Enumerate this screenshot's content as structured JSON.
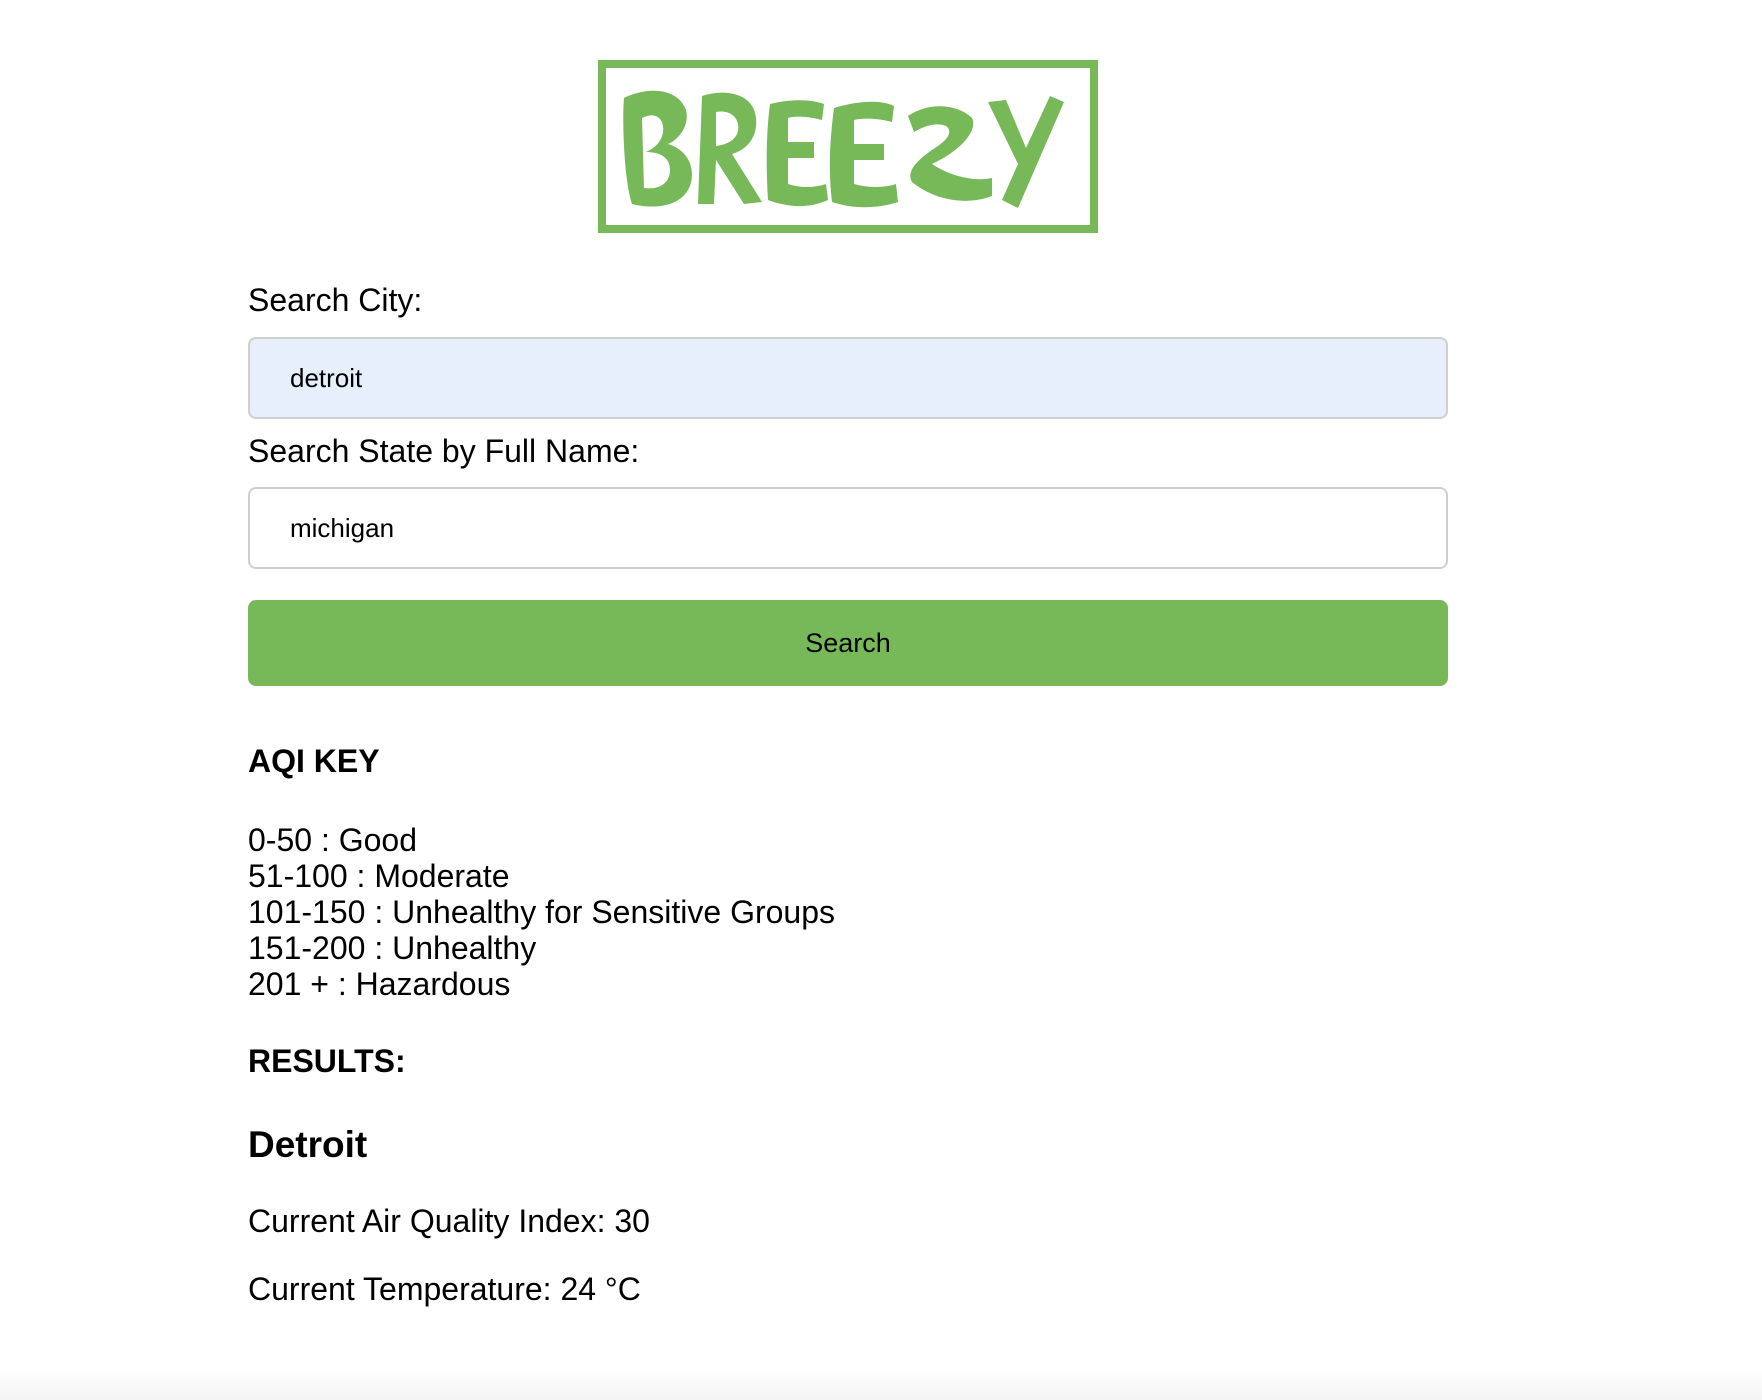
{
  "logo": {
    "text": "BREEZY"
  },
  "colors": {
    "brand_green": "#77b959",
    "city_input_bg": "#e8effc",
    "state_input_bg": "#ffffff"
  },
  "search": {
    "city_label": "Search City:",
    "city_value": "detroit",
    "state_label": "Search State by Full Name:",
    "state_value": "michigan",
    "button_label": "Search"
  },
  "aqi_key": {
    "title": "AQI KEY",
    "items": [
      "0-50 : Good",
      "51-100 : Moderate",
      "101-150 : Unhealthy for Sensitive Groups",
      "151-200 : Unhealthy",
      "201 + : Hazardous"
    ]
  },
  "results": {
    "title": "RESULTS:",
    "city": "Detroit",
    "aqi_text": "Current Air Quality Index: 30",
    "temperature_text": "Current Temperature: 24 °C"
  }
}
